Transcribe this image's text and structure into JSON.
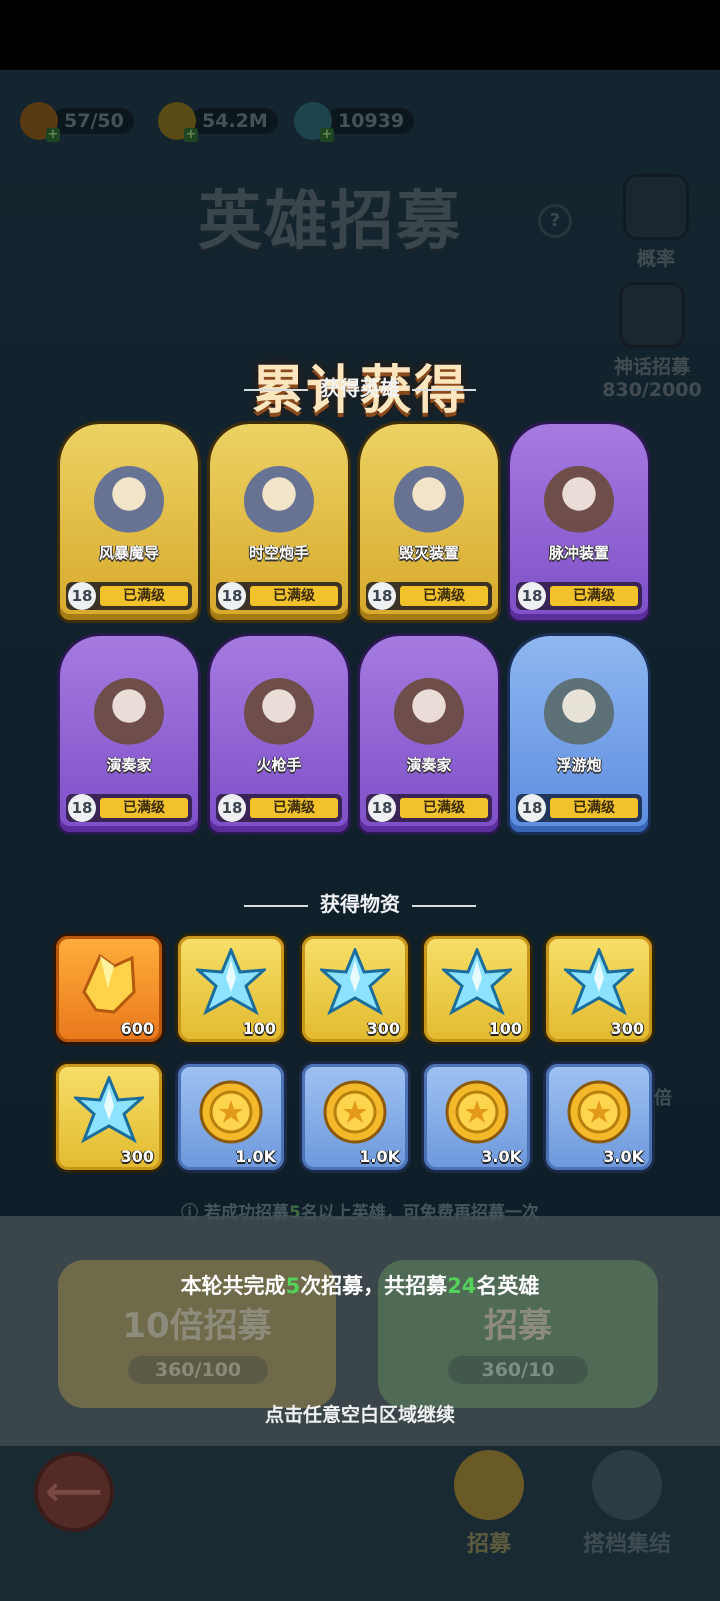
{
  "resources": {
    "stamina": "57/50",
    "gold": "54.2M",
    "crystal": "10939"
  },
  "background": {
    "title": "英雄招募",
    "help_symbol": "?",
    "rate_label": "概率",
    "mythic_label": "神话招募",
    "mythic_progress": "830/2000",
    "tip_prefix": "若成功招募",
    "tip_num": "5",
    "tip_suffix": "名以上英雄，可免费再招募一次",
    "btn_ten": "10倍招募",
    "btn_ten_cost": "360/100",
    "btn_one": "招募",
    "btn_one_cost": "360/10",
    "side_mult": "倍",
    "nav_recruit": "招募",
    "nav_team": "搭档集结",
    "back_symbol": "⟵"
  },
  "result": {
    "title": "累计获得",
    "heroes_header": "获得英雄",
    "items_header": "获得物资",
    "heroes": [
      {
        "name": "风暴魔导",
        "level": "18",
        "status": "已满级",
        "rarity": "gold"
      },
      {
        "name": "时空炮手",
        "level": "18",
        "status": "已满级",
        "rarity": "gold"
      },
      {
        "name": "毁灭装置",
        "level": "18",
        "status": "已满级",
        "rarity": "gold"
      },
      {
        "name": "脉冲装置",
        "level": "18",
        "status": "已满级",
        "rarity": "purple"
      },
      {
        "name": "演奏家",
        "level": "18",
        "status": "已满级",
        "rarity": "purple"
      },
      {
        "name": "火枪手",
        "level": "18",
        "status": "已满级",
        "rarity": "purple"
      },
      {
        "name": "演奏家",
        "level": "18",
        "status": "已满级",
        "rarity": "purple"
      },
      {
        "name": "浮游炮",
        "level": "18",
        "status": "已满级",
        "rarity": "blue"
      }
    ],
    "items": [
      {
        "icon": "orange-crystal-icon",
        "qty": "600",
        "frame": "orange"
      },
      {
        "icon": "blue-crystal-icon",
        "qty": "100",
        "frame": "gold"
      },
      {
        "icon": "blue-crystal-icon",
        "qty": "300",
        "frame": "gold"
      },
      {
        "icon": "blue-crystal-icon",
        "qty": "100",
        "frame": "gold"
      },
      {
        "icon": "blue-crystal-icon",
        "qty": "300",
        "frame": "gold"
      },
      {
        "icon": "blue-crystal-icon",
        "qty": "300",
        "frame": "gold"
      },
      {
        "icon": "gold-coin-icon",
        "qty": "1.0K",
        "frame": "blue"
      },
      {
        "icon": "gold-coin-icon",
        "qty": "1.0K",
        "frame": "blue"
      },
      {
        "icon": "gold-coin-icon",
        "qty": "3.0K",
        "frame": "blue"
      },
      {
        "icon": "gold-coin-icon",
        "qty": "3.0K",
        "frame": "blue"
      }
    ],
    "summary": {
      "p1": "本轮共完成",
      "recruits": "5",
      "p2": "次招募，共招募",
      "heroes": "24",
      "p3": "名英雄"
    },
    "continue_text": "点击任意空白区域继续"
  },
  "colors": {
    "highlight_green": "#54d15a",
    "gold_card": "#d7a92b",
    "purple_card": "#7e4fc8",
    "blue_card": "#5d8de0"
  }
}
